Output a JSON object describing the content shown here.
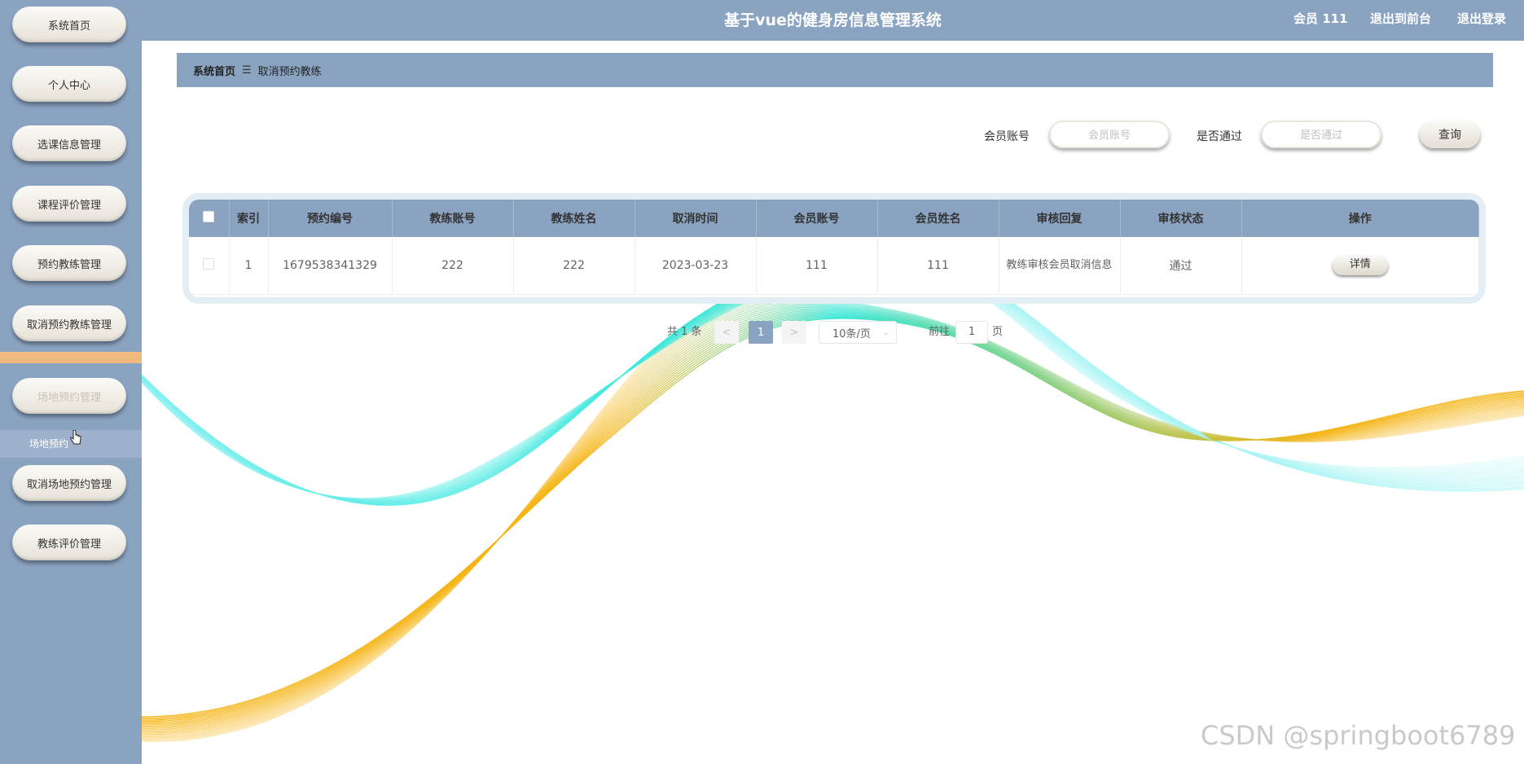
{
  "header": {
    "title": "基于vue的健身房信息管理系统",
    "user": "会员 111",
    "front_link": "退出到前台",
    "logout_link": "退出登录"
  },
  "sidebar": {
    "items": [
      {
        "label": "系统首页"
      },
      {
        "label": "个人中心"
      },
      {
        "label": "选课信息管理"
      },
      {
        "label": "课程评价管理"
      },
      {
        "label": "预约教练管理"
      },
      {
        "label": "取消预约教练管理"
      },
      {
        "label": "场地预约管理"
      },
      {
        "label": "取消场地预约管理"
      },
      {
        "label": "教练评价管理"
      }
    ],
    "sub_item": "场地预约"
  },
  "breadcrumb": {
    "home": "系统首页",
    "separator": "☰",
    "current": "取消预约教练"
  },
  "search": {
    "member_label": "会员账号",
    "member_placeholder": "会员账号",
    "pass_label": "是否通过",
    "pass_placeholder": "是否通过",
    "query_button": "查询"
  },
  "table": {
    "headers": [
      "索引",
      "预约编号",
      "教练账号",
      "教练姓名",
      "取消时间",
      "会员账号",
      "会员姓名",
      "审核回复",
      "审核状态",
      "操作"
    ],
    "rows": [
      {
        "index": "1",
        "booking_no": "1679538341329",
        "coach_account": "222",
        "coach_name": "222",
        "cancel_time": "2023-03-23",
        "member_account": "111",
        "member_name": "111",
        "reply": "教练审核会员取消信息",
        "status": "通过",
        "action": "详情"
      }
    ]
  },
  "pagination": {
    "total": "共 1 条",
    "prev": "<",
    "current_page": "1",
    "next": ">",
    "page_size": "10条/页",
    "goto_label": "前往",
    "goto_value": "1",
    "page_suffix": "页"
  },
  "watermark": "CSDN @springboot6789",
  "colors": {
    "primary": "#8aa3c1",
    "active_bar": "#f2b97f",
    "wave_teal": "#2fe6d8",
    "wave_yellow": "#f5b414"
  }
}
